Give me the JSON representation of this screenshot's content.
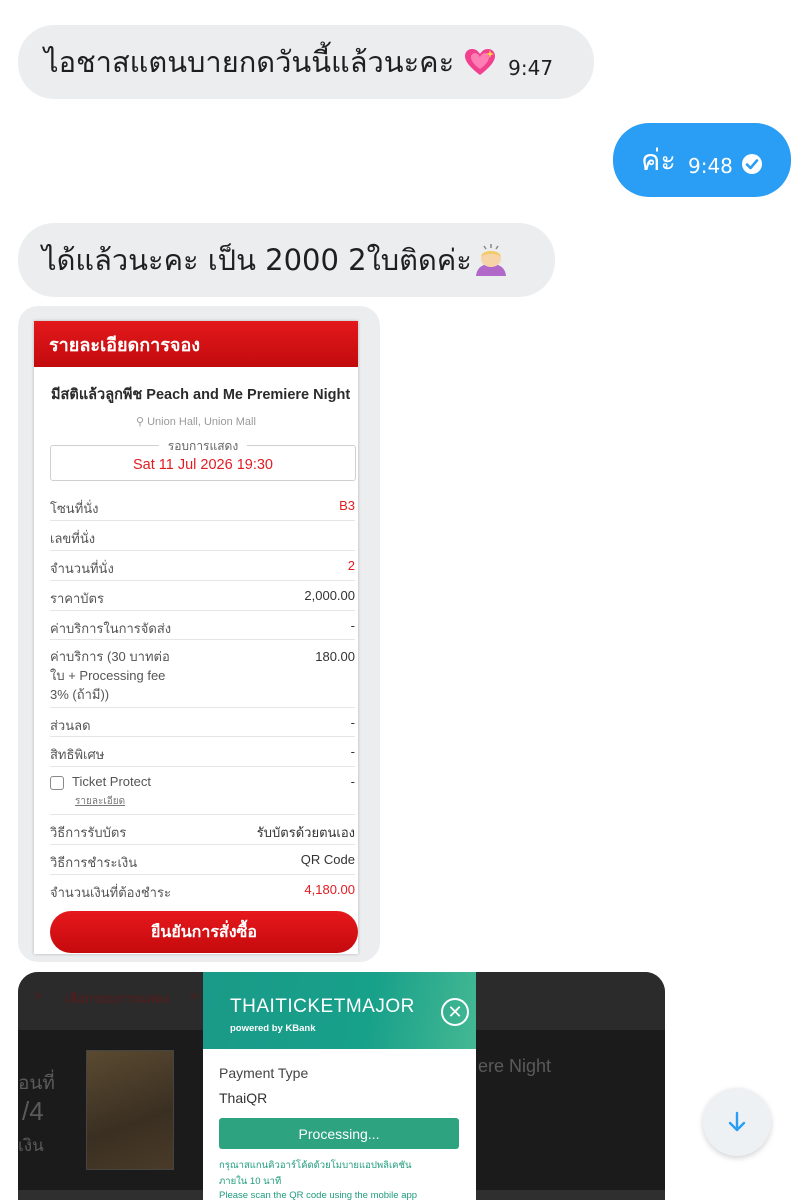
{
  "messages": [
    {
      "text": "ไอชาสแตนบายกดวันนี้แล้วนะคะ",
      "emoji": "sparkling-heart",
      "time": "9:47"
    },
    {
      "text": "ค่ะ",
      "time": "9:48"
    },
    {
      "text": "ได้แล้วนะคะ เป็น 2000 2ใบติดค่ะ",
      "emoji": "person-bowing"
    }
  ],
  "booking": {
    "header": "รายละเอียดการจอง",
    "event": "มีสติแล้วลูกพีช Peach and Me Premiere Night",
    "venue": "Union Hall, Union Mall",
    "show_label": "รอบการแสดง",
    "show_date": "Sat 11 Jul 2026 19:30",
    "rows": {
      "zone": {
        "label": "โซนที่นั่ง",
        "value": "B3"
      },
      "seat": {
        "label": "เลขที่นั่ง",
        "value": ""
      },
      "qty": {
        "label": "จำนวนที่นั่ง",
        "value": "2"
      },
      "price": {
        "label": "ราคาบัตร",
        "value": "2,000.00"
      },
      "delivery": {
        "label": "ค่าบริการในการจัดส่ง",
        "value": "-"
      },
      "service": {
        "label_lines": [
          "ค่าบริการ (30 บาทต่อ",
          "ใบ + Processing fee",
          "3% (ถ้ามี))"
        ],
        "value": "180.00"
      },
      "discount": {
        "label": "ส่วนลด",
        "value": "-"
      },
      "privilege": {
        "label": "สิทธิพิเศษ",
        "value": "-"
      },
      "protect": {
        "label": "Ticket Protect",
        "link": "รายละเอียด",
        "value": "-"
      },
      "pickup": {
        "label": "วิธีการรับบัตร",
        "value": "รับบัตรด้วยตนเอง"
      },
      "payment": {
        "label": "วิธีการชำระเงิน",
        "value": "QR Code"
      },
      "total": {
        "label": "จำนวนเงินที่ต้องชำระ",
        "value": "4,180.00"
      }
    },
    "confirm_label": "ยืนยันการสั่งซื้อ"
  },
  "payment_shot": {
    "breadcrumb_sep": ">",
    "breadcrumb": "เลือกรอบการแสดง",
    "bg_title_tail": "ere Night",
    "bg_left_1": "อนที่",
    "bg_left_2": "/4",
    "bg_left_3": "เงิน",
    "brand": "THAITICKETMAJOR",
    "brand_sub": "powered by KBank",
    "close": "✕",
    "payment_type_label": "Payment Type",
    "payment_type": "ThaiQR",
    "processing": "Processing...",
    "note_th_1": "กรุณาสแกนคิวอาร์โค้ดด้วยโมบายแอปพลิเคชัน",
    "note_th_2": "ภายใน 10 นาที",
    "note_en": "Please scan the QR code using the mobile app"
  },
  "icons": {
    "check": "check-circle-icon",
    "scroll": "arrow-down-icon",
    "pin": "map-pin-icon"
  },
  "colors": {
    "outgoing": "#2a9df4",
    "incoming": "#ebedef",
    "brand_red": "#e01c21",
    "kbank_green": "#1a9a88"
  }
}
